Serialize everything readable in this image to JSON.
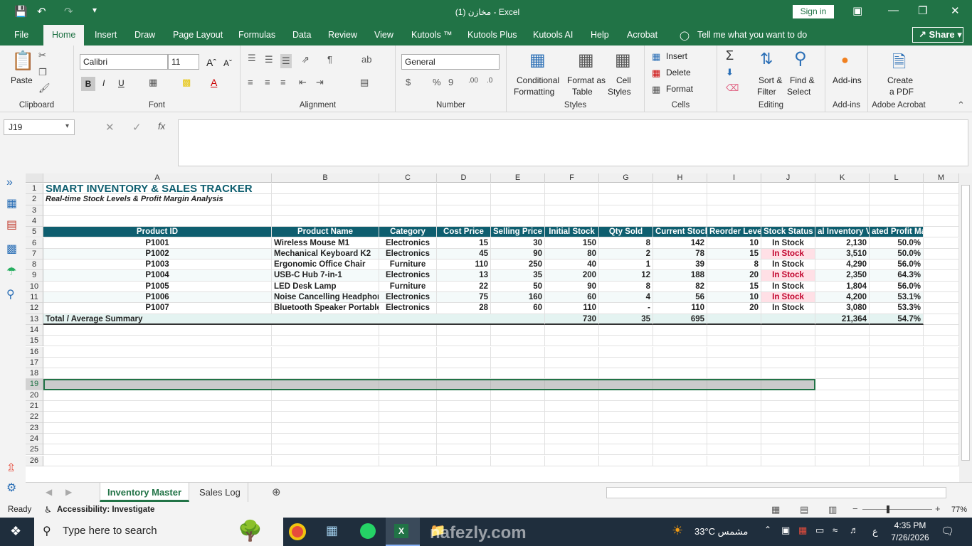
{
  "title": {
    "text": "مخازن (1)  -  Excel",
    "signin": "Sign in"
  },
  "menu": [
    "File",
    "Home",
    "Insert",
    "Draw",
    "Page Layout",
    "Formulas",
    "Data",
    "Review",
    "View",
    "Kutools ™",
    "Kutools Plus",
    "Kutools AI",
    "Help",
    "Acrobat"
  ],
  "tellme": "Tell me what you want to do",
  "share": "Share",
  "ribbon": {
    "clipboard": {
      "label": "Clipboard",
      "paste": "Paste"
    },
    "font": {
      "label": "Font",
      "name": "Calibri",
      "size": "11"
    },
    "alignment": {
      "label": "Alignment"
    },
    "number": {
      "label": "Number",
      "format": "General"
    },
    "styles": {
      "label": "Styles",
      "conditional": "Conditional",
      "formatting": "Formatting",
      "format_as": "Format as",
      "table": "Table",
      "cell": "Cell",
      "cell_styles": "Styles"
    },
    "cells": {
      "label": "Cells",
      "insert": "Insert",
      "delete": "Delete",
      "format": "Format"
    },
    "editing": {
      "label": "Editing",
      "sort": "Sort &",
      "filter": "Filter",
      "find": "Find &",
      "select": "Select"
    },
    "addins": {
      "label": "Add-ins",
      "btn": "Add-ins"
    },
    "acrobat": {
      "label": "Adobe Acrobat",
      "create": "Create",
      "pdf": "a PDF"
    }
  },
  "namebox": "J19",
  "columns": [
    "A",
    "B",
    "C",
    "D",
    "E",
    "F",
    "G",
    "H",
    "I",
    "J",
    "K",
    "L",
    "M"
  ],
  "sheet": {
    "title": "SMART INVENTORY & SALES TRACKER",
    "subtitle": "Real-time Stock Levels & Profit Margin Analysis",
    "headers": [
      "Product ID",
      "Product Name",
      "Category",
      "Cost Price",
      "Selling Price",
      "Initial Stock",
      "Qty Sold",
      "Current Stock",
      "Reorder Level",
      "Stock Status",
      "al Inventory Va",
      "ated Profit Ma"
    ],
    "rows": [
      [
        "P1001",
        "Wireless Mouse M1",
        "Electronics",
        "15",
        "30",
        "150",
        "8",
        "142",
        "10",
        "In Stock",
        "2,130",
        "50.0%"
      ],
      [
        "P1002",
        "Mechanical Keyboard K2",
        "Electronics",
        "45",
        "90",
        "80",
        "2",
        "78",
        "15",
        "In Stock",
        "3,510",
        "50.0%"
      ],
      [
        "P1003",
        "Ergonomic Office Chair",
        "Furniture",
        "110",
        "250",
        "40",
        "1",
        "39",
        "8",
        "In Stock",
        "4,290",
        "56.0%"
      ],
      [
        "P1004",
        "USB-C Hub 7-in-1",
        "Electronics",
        "13",
        "35",
        "200",
        "12",
        "188",
        "20",
        "In Stock",
        "2,350",
        "64.3%"
      ],
      [
        "P1005",
        "LED Desk Lamp",
        "Furniture",
        "22",
        "50",
        "90",
        "8",
        "82",
        "15",
        "In Stock",
        "1,804",
        "56.0%"
      ],
      [
        "P1006",
        "Noise Cancelling Headphones",
        "Electronics",
        "75",
        "160",
        "60",
        "4",
        "56",
        "10",
        "In Stock",
        "4,200",
        "53.1%"
      ],
      [
        "P1007",
        "Bluetooth Speaker Portable",
        "Electronics",
        "28",
        "60",
        "110",
        "-",
        "110",
        "20",
        "In Stock",
        "3,080",
        "53.3%"
      ]
    ],
    "highlight_status": [
      false,
      true,
      false,
      true,
      false,
      true,
      false
    ],
    "total": {
      "label": "Total / Average Summary",
      "initial": "730",
      "sold": "35",
      "current": "695",
      "value": "21,364",
      "margin": "54.7%"
    }
  },
  "tabs": [
    "Inventory Master",
    "Sales Log"
  ],
  "status": {
    "ready": "Ready",
    "access": "Accessibility: Investigate",
    "zoom": "77%"
  },
  "taskbar": {
    "search": "Type here to search",
    "weather": "33°C  مشمس",
    "time": "4:35 PM",
    "date": "7/26/2026",
    "lang": "ع"
  },
  "watermark": "nafezly.com"
}
